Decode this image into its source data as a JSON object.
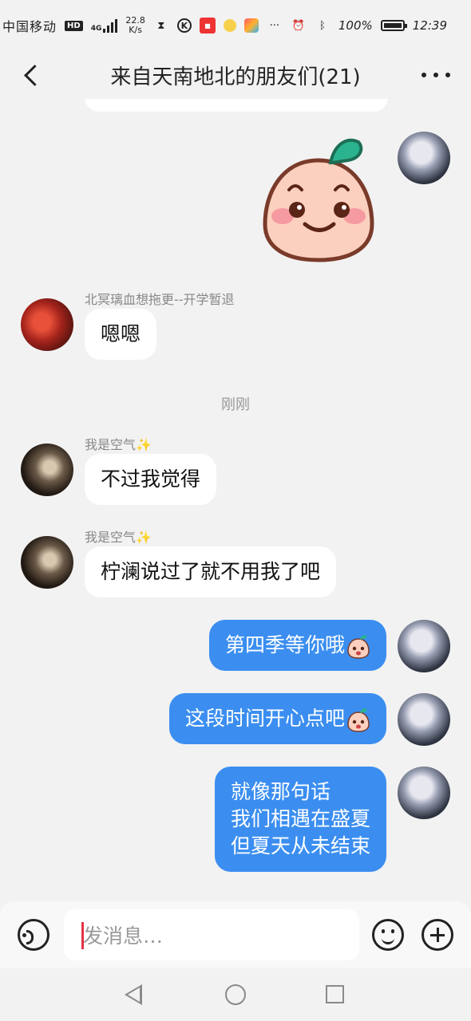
{
  "status_bar": {
    "carrier": "中国移动",
    "hd_badge": "HD",
    "network": "4G",
    "speed_value": "22.8",
    "speed_unit": "K/s",
    "battery": "100%",
    "time": "12:39",
    "icons": [
      "hourglass-icon",
      "k-app-icon",
      "red-app-icon",
      "yellow-app-icon",
      "multicolor-app-icon",
      "more-dots-icon",
      "alarm-icon",
      "bluetooth-icon",
      "battery-icon"
    ]
  },
  "header": {
    "title": "来自天南地北的朋友们(21)"
  },
  "messages": [
    {
      "type": "sticker",
      "from": "me",
      "sticker": "peach-smile-sticker"
    },
    {
      "type": "text",
      "from": "other",
      "sender": "北冥璃血想拖更--开学暂退",
      "text": "嗯嗯"
    },
    {
      "type": "time",
      "text": "刚刚"
    },
    {
      "type": "text",
      "from": "other",
      "sender": "我是空气",
      "sender_emoji": "✨",
      "text": "不过我觉得"
    },
    {
      "type": "text",
      "from": "other",
      "sender": "我是空气",
      "sender_emoji": "✨",
      "text": "柠澜说过了就不用我了吧"
    },
    {
      "type": "text",
      "from": "me",
      "text": "第四季等你哦",
      "emoji": "peach-emoji"
    },
    {
      "type": "text",
      "from": "me",
      "text": "这段时间开心点吧",
      "emoji": "peach-emoji"
    },
    {
      "type": "text",
      "from": "me",
      "text": "就像那句话\n我们相遇在盛夏\n但夏天从未结束"
    }
  ],
  "input_bar": {
    "placeholder": "发消息…"
  },
  "colors": {
    "my_bubble": "#3b8ef0",
    "other_bubble": "#ffffff",
    "background": "#f2f2f2",
    "caret": "#e23344"
  }
}
